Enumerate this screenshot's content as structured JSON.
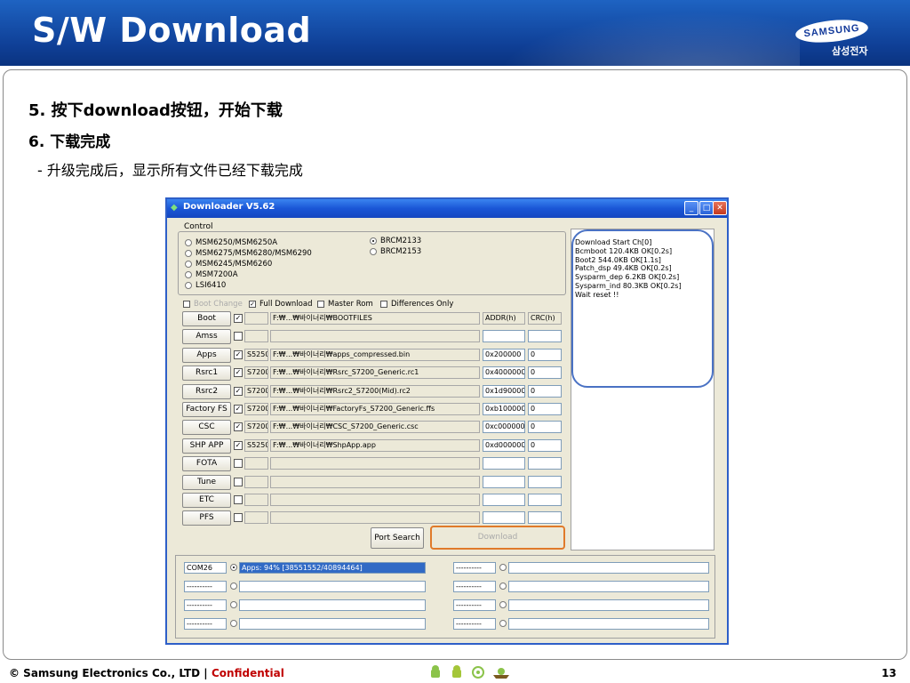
{
  "slide": {
    "title": "S/W Download",
    "logo_text": "SAMSUNG",
    "logo_sub": "삼성전자",
    "step5": "5.  按下download按钮，开始下载",
    "step6": "6.  下载完成",
    "step6_sub": "- 升级完成后，显示所有文件已经下载完成",
    "footer_copyright": "© Samsung Electronics Co., LTD  |",
    "footer_confidential": "Confidential",
    "page_number": "13"
  },
  "window": {
    "title": "Downloader V5.62",
    "control_label": "Control",
    "radios_left": [
      "MSM6250/MSM6250A",
      "MSM6275/MSM6280/MSM6290",
      "MSM6245/MSM6260",
      "MSM7200A",
      "LSI6410"
    ],
    "radios_right": [
      "BRCM2133",
      "BRCM2153"
    ],
    "selected_radio": "BRCM2133",
    "options": {
      "boot_change": "Boot Change",
      "full_download": "Full Download",
      "master_rom": "Master Rom",
      "differences_only": "Differences Only"
    },
    "files": [
      {
        "label": "Boot",
        "checked": true,
        "model": "",
        "path": "F:₩...₩바이너리₩BOOTFILES",
        "addr": "ADDR(h)",
        "crc": "CRC(h)"
      },
      {
        "label": "Amss",
        "checked": false,
        "model": "",
        "path": "",
        "addr": "",
        "crc": ""
      },
      {
        "label": "Apps",
        "checked": true,
        "model": "S5250",
        "path": "F:₩...₩바이너리₩apps_compressed.bin",
        "addr": "0x200000",
        "crc": "0"
      },
      {
        "label": "Rsrc1",
        "checked": true,
        "model": "S7200",
        "path": "F:₩...₩바이너리₩Rsrc_S7200_Generic.rc1",
        "addr": "0x4000000",
        "crc": "0"
      },
      {
        "label": "Rsrc2",
        "checked": true,
        "model": "S7200",
        "path": "F:₩...₩바이너리₩Rsrc2_S7200(Mid).rc2",
        "addr": "0x1d900000",
        "crc": "0"
      },
      {
        "label": "Factory FS",
        "checked": true,
        "model": "S7200",
        "path": "F:₩...₩바이너리₩FactoryFs_S7200_Generic.ffs",
        "addr": "0xb100000",
        "crc": "0"
      },
      {
        "label": "CSC",
        "checked": true,
        "model": "S7200",
        "path": "F:₩...₩바이너리₩CSC_S7200_Generic.csc",
        "addr": "0xc0000000",
        "crc": "0"
      },
      {
        "label": "SHP APP",
        "checked": true,
        "model": "S5250",
        "path": "F:₩...₩바이너리₩ShpApp.app",
        "addr": "0xd0000000",
        "crc": "0"
      },
      {
        "label": "FOTA",
        "checked": false,
        "model": "",
        "path": "",
        "addr": "",
        "crc": ""
      },
      {
        "label": "Tune",
        "checked": false,
        "model": "",
        "path": "",
        "addr": "",
        "crc": ""
      },
      {
        "label": "ETC",
        "checked": false,
        "model": "",
        "path": "",
        "addr": "",
        "crc": ""
      },
      {
        "label": "PFS",
        "checked": false,
        "model": "",
        "path": "",
        "addr": "",
        "crc": ""
      }
    ],
    "port_search": "Port Search",
    "download": "Download",
    "log": [
      "Download Start Ch[0]",
      "Bcmboot 120.4KB OK[0.2s]",
      "Boot2 544.0KB OK[1.1s]",
      "Patch_dsp 49.4KB OK[0.2s]",
      "Sysparm_dep 6.2KB OK[0.2s]",
      "Sysparm_ind 80.3KB OK[0.2s]",
      "Wait reset !!"
    ],
    "ports": {
      "left": [
        {
          "port": "COM26",
          "status": "Apps:  94%  [38551552/40894464]",
          "selected": true
        },
        {
          "port": "----------",
          "status": "",
          "selected": false
        },
        {
          "port": "----------",
          "status": "",
          "selected": false
        },
        {
          "port": "----------",
          "status": "",
          "selected": false
        }
      ],
      "right": [
        {
          "port": "----------",
          "status": "",
          "selected": false
        },
        {
          "port": "----------",
          "status": "",
          "selected": false
        },
        {
          "port": "----------",
          "status": "",
          "selected": false
        },
        {
          "port": "----------",
          "status": "",
          "selected": false
        }
      ]
    }
  }
}
